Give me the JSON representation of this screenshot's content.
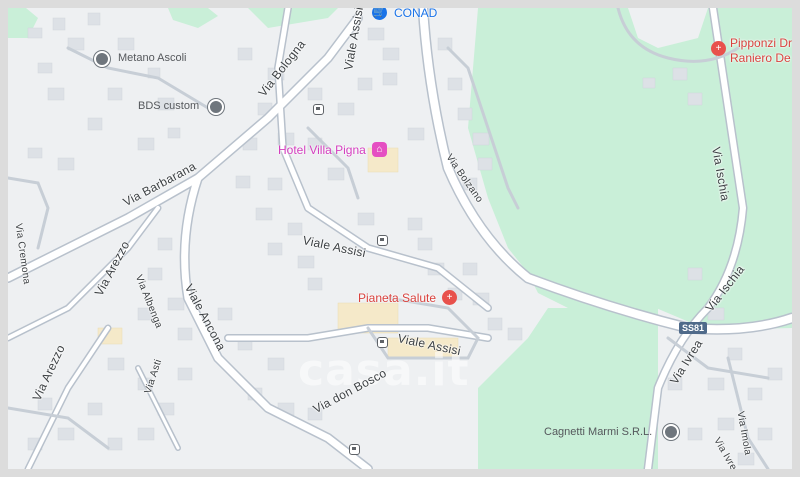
{
  "map": {
    "colors": {
      "park": "#c9efd8",
      "base": "#eef0f2",
      "road": "#ffffff",
      "road_edge": "#b8c1cc",
      "building": "#dde1e6",
      "poi_red": "#e8514c",
      "poi_pink": "#e54fc2",
      "poi_blue": "#1a73e8"
    },
    "pois": [
      {
        "name": "CONAD",
        "icon": "shopping-cart-icon",
        "color": "#1a73e8"
      },
      {
        "name": "Hotel Villa Pigna",
        "icon": "hotel-bed-icon",
        "color": "#d43fbf"
      },
      {
        "name": "Pianeta Salute",
        "icon": "medical-icon",
        "color": "#d9423e"
      },
      {
        "name": "Pipponzi Dr",
        "icon": "medical-icon",
        "color": "#d9423e"
      },
      {
        "name": "Raniero De",
        "icon": "",
        "color": "#d9423e"
      },
      {
        "name": "Metano Ascoli",
        "icon": "place-dot-icon",
        "color": "#55585c"
      },
      {
        "name": "BDS custom",
        "icon": "place-dot-icon",
        "color": "#55585c"
      },
      {
        "name": "Cagnetti Marmi S.R.L.",
        "icon": "place-dot-icon",
        "color": "#55585c"
      }
    ],
    "streets": [
      "Via Bologna",
      "Viale Assisi",
      "Via Barbarana",
      "Via Cremona",
      "Via Bolzano",
      "Via Ischia",
      "Viale Assisi",
      "Viale Assisi",
      "Via Arezzo",
      "Via Albenga",
      "Viale Ancona",
      "Via Arezzo",
      "Via Asti",
      "Via don Bosco",
      "Via Ischia",
      "Via Ivrea",
      "Via Imola",
      "Via Ivrea"
    ],
    "route_shield": "SS81",
    "watermark": "casa.it"
  }
}
